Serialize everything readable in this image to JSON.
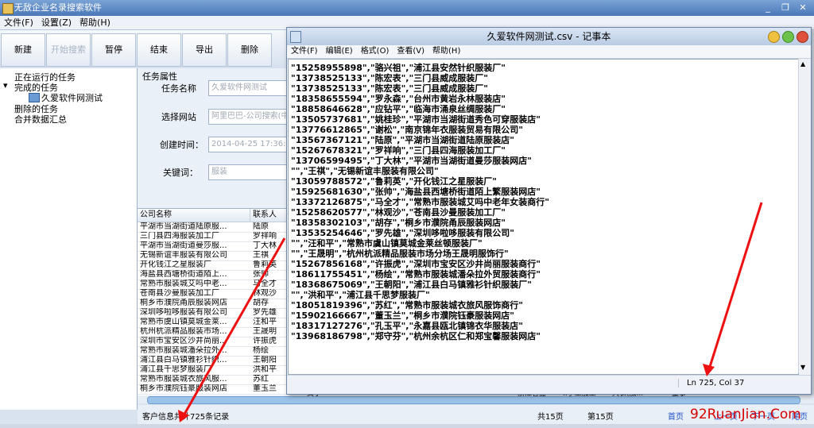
{
  "app": {
    "title": "无敌企业名录搜索软件",
    "menu": [
      "文件(F)",
      "设置(Z)",
      "帮助(H)"
    ],
    "toolbar": [
      "新建",
      "开始搜索",
      "暂停",
      "结束",
      "导出",
      "删除"
    ]
  },
  "tree": {
    "items": [
      "正在运行的任务",
      "完成的任务",
      "久爱软件网测试",
      "删除的任务",
      "合并数据汇总"
    ]
  },
  "props": {
    "section_title": "任务属性",
    "name_label": "任务名称",
    "name_value": "久爱软件网测试",
    "site_label": "选择网站",
    "site_value": "阿里巴巴-公司搜索(中",
    "created_label": "创建时间：",
    "created_value": "2014-04-25 17:36:13",
    "keyword_label": "关键词：",
    "keyword_value": "服装"
  },
  "grid": {
    "headers": [
      "公司名称",
      "联系人"
    ],
    "rows": [
      [
        "平湖市当湖街道陆原服...",
        "陆原"
      ],
      [
        "三门县四海服装加工厂",
        "罗祥响"
      ],
      [
        "平湖市当湖街道曼莎服...",
        "丁大林"
      ],
      [
        "无锡新谊丰服装有限公司",
        "王祺"
      ],
      [
        "开化钱江之星服装厂",
        "鲁莉英"
      ],
      [
        "海盐县西塘桥街道陌上...",
        "张帅"
      ],
      [
        "常熟市服装城艾吗中老...",
        "马全才"
      ],
      [
        "苍南县沙曼服装加工厂",
        "林观沙"
      ],
      [
        "桐乡市濮院甬辰服装网店",
        "胡存"
      ],
      [
        "深圳哆啦哆服装有限公司",
        "罗先雄"
      ],
      [
        "常熟市虞山镇莫城金莱...",
        "汪和平"
      ],
      [
        "杭州杭派精品服装市场...",
        "王晟明"
      ],
      [
        "深圳市宝安区沙井尚丽...",
        "许振虎"
      ],
      [
        "常熟市服装城潘朵拉外...",
        "杨绘"
      ],
      [
        "浦江县白马镇雅衫针织...",
        "王朝阳"
      ],
      [
        "浦江县千思梦服装厂",
        "洪和平"
      ],
      [
        "常熟市服装城衣旅风服...",
        "苏红"
      ],
      [
        "桐乡市濮院钰豪服装网店",
        "董玉兰"
      ]
    ],
    "extra_row": [
      "女子",
      "15902166667",
      "86-0573155...",
      "浙江省嘉",
      "..手工加工",
      "大衣(加...",
      "董事一",
      "2013",
      "101 - 200..."
    ]
  },
  "status": {
    "count": "客户信息共计725条记录",
    "total_pages": "共15页",
    "current_page": "第15页",
    "first": "首页",
    "prev": "上一页",
    "next": "下一页",
    "last": "尾页"
  },
  "notepad": {
    "title": "久爱软件网测试.csv - 记事本",
    "menu": [
      "文件(F)",
      "编辑(E)",
      "格式(O)",
      "查看(V)",
      "帮助(H)"
    ],
    "lines": [
      "\"15258955898\",\"骆兴祖\",\"浦江县安然针织服装厂\"",
      "\"13738525133\",\"陈宏表\",\"三门县威成服装厂\"",
      "\"13738525133\",\"陈宏表\",\"三门县威成服装厂\"",
      "\"18358655594\",\"罗永森\",\"台州市黄岩永林服装店\"",
      "\"18858646628\",\"应钻平\",\"临海市涌泉丝绸服装厂\"",
      "\"13505737681\",\"姚桂珍\",\"平湖市当湖街道秀色可穿服装店\"",
      "\"13776612865\",\"谢松\",\"南京锦年衣服装贸易有限公司\"",
      "\"13567367121\",\"陆原\",\"平湖市当湖街道陆原服装店\"",
      "\"15267678321\",\"罗祥响\",\"三门县四海服装加工厂\"",
      "\"13706599495\",\"丁大林\",\"平湖市当湖街道曼莎服装网店\"",
      "\"\",\"王祺\",\"无锡新谊丰服装有限公司\"",
      "\"13059788572\",\"鲁莉英\",\"开化钱江之星服装厂\"",
      "\"15925681630\",\"张帅\",\"海盐县西塘桥街道陌上繁服装网店\"",
      "\"13372126875\",\"马全才\",\"常熟市服装城艾吗中老年女装商行\"",
      "\"15258620577\",\"林观沙\",\"苍南县沙曼服装加工厂\"",
      "\"18358302103\",\"胡存\",\"桐乡市濮院甬辰服装网店\"",
      "\"13535254646\",\"罗先雄\",\"深圳哆啦哆服装有限公司\"",
      "\"\",\"汪和平\",\"常熟市虞山镇莫城金莱丝顿服装厂\"",
      "\"\",\"王晟明\",\"杭州杭派精品服装市场分场王晟明服饰行\"",
      "\"15267856168\",\"许振虎\",\"深圳市宝安区沙井尚丽服装商行\"",
      "\"18611755451\",\"杨绘\",\"常熟市服装城潘朵拉外贸服装商行\"",
      "\"18368675069\",\"王朝阳\",\"浦江县白马镇雅衫针织服装厂\"",
      "\"\",\"洪和平\",\"浦江县千思梦服装厂\"",
      "\"18051819396\",\"苏红\",\"常熟市服装城衣旅风服饰商行\"",
      "\"15902166667\",\"董玉兰\",\"桐乡市濮院钰豪服装网店\"",
      "\"18317127276\",\"孔玉平\",\"永嘉县瓯北镇锦衣华服装店\"",
      "\"13968186798\",\"郑守芬\",\"杭州余杭区仁和郑宝馨服装网店\""
    ],
    "status": "Ln 725, Col 37"
  },
  "watermark": "92RuanJian.Com"
}
